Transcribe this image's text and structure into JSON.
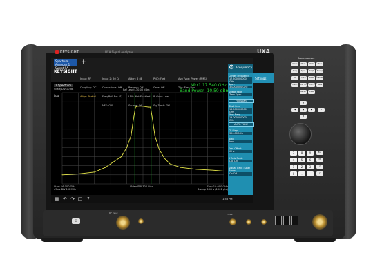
{
  "instrument": {
    "brand": "KEYSIGHT",
    "model_line": "UXA Signal Analyzer",
    "model_badge": "UXA",
    "measurement_group_label": "Measurement",
    "connector_label_left": "RF Input",
    "connector_label_right": "Probe"
  },
  "screen": {
    "logo_lines": [
      "Spectrum Analyzer 1",
      "Swept SA"
    ],
    "logo_color": "#1d58a8",
    "brand_text": "KEYSIGHT",
    "status_columns": [
      {
        "lines": [
          "Input: RF",
          "Coupling: DC",
          "Align: Partial"
        ],
        "color": "#cfcfcf"
      },
      {
        "lines": [
          "Input Z: 50 Ω",
          "Corrections: Off",
          "Freq Ref: Ext (S)",
          "NFE: Off"
        ],
        "color": "#cfcfcf"
      },
      {
        "lines": [
          "Atten: 6 dB",
          "Preamp: Off",
          "LNA: Not Enabled",
          "Source: Off"
        ],
        "color": "#cfcfcf"
      },
      {
        "lines": [
          "PNO: Fast",
          "Gate: Off",
          "IF Gain: Low",
          "Sig Track: Off"
        ],
        "color": "#cfcfcf"
      },
      {
        "lines": [
          "Avg Type: Power (RMS)",
          "Trig: Free Run"
        ],
        "color": "#cfcfcf"
      }
    ],
    "trace_label": "1 Spectrum",
    "scale_label": "Scale/Div 10 dB",
    "ref_label": "Ref Level -10.00 dBm",
    "marker_readout": "Mkr1  17.540 GHz",
    "band_power_readout": "Band Power  -10.50 dBm",
    "y_tick_top": "Log",
    "footer": {
      "start": "Start 16.000 GHz",
      "res_bw": "#Res BW 1.0 MHz",
      "video_bw": "Video BW 300 kHz",
      "stop": "Stop 19.000 GHz",
      "sweep": "Sweep 3.45 s (1001 pts)"
    },
    "taskbar_icons": [
      "windows-icon",
      "undo-icon",
      "redo-icon",
      "file-icon",
      "help-icon"
    ],
    "taskbar_time": "1:53 PM"
  },
  "menu_panel": {
    "title": "Frequency",
    "side_tab": "Settings",
    "items": [
      {
        "label": "Center Frequency",
        "value": "17.500000000 GHz"
      },
      {
        "label": "Span",
        "value": "3.0000000 GHz"
      },
      {
        "label": "Swept Span",
        "value": "Zero Span"
      },
      {
        "label": "Full Span",
        "value": ""
      },
      {
        "label": "Start Freq",
        "value": "16.000000000 GHz"
      },
      {
        "label": "Stop Freq",
        "value": "19.000000000 GHz"
      },
      {
        "label": "AUTO TUNE",
        "value": ""
      },
      {
        "label": "CF Step",
        "value": "300.00 MHz"
      },
      {
        "label": "Auto",
        "value": "Man"
      },
      {
        "label": "Freq Offset",
        "value": "0 Hz"
      },
      {
        "label": "X Axis Scale",
        "value": "Log Lin"
      },
      {
        "label": "Signal Track (Span Zoom)",
        "value": "On Off"
      }
    ],
    "panel_color": "#1f8fb1"
  },
  "hardkeys": [
    {
      "label": "Mode"
    },
    {
      "label": "Meas"
    },
    {
      "label": "Mode Setup"
    },
    {
      "label": "Meas Setup"
    },
    {
      "label": "Freq"
    },
    {
      "label": "Span"
    },
    {
      "label": "Ampt"
    },
    {
      "label": "Sweep"
    },
    {
      "label": "BW"
    },
    {
      "label": "Trace"
    },
    {
      "label": "Peak"
    },
    {
      "label": "Marker"
    },
    {
      "label": "Mkr→"
    },
    {
      "label": "Mkr Fn"
    },
    {
      "label": "Source"
    },
    {
      "label": "Save"
    },
    {
      "label": "Recall"
    },
    {
      "label": "Preset"
    }
  ],
  "keypad": [
    "7",
    "8",
    "9",
    "4",
    "5",
    "6",
    "1",
    "2",
    "3",
    "0",
    ".",
    "-"
  ],
  "chart_data": {
    "type": "line",
    "x_start_ghz": 16.0,
    "x_stop_ghz": 19.0,
    "ylim": [
      -110,
      -10
    ],
    "grid": true,
    "series": [
      {
        "name": "Trace 1",
        "color": "#e8e84a",
        "x": [
          16.0,
          16.3,
          16.6,
          16.8,
          16.95,
          17.1,
          17.2,
          17.28,
          17.32,
          17.36,
          17.4,
          17.5,
          17.6,
          17.64,
          17.68,
          17.72,
          17.8,
          17.9,
          18.0,
          18.2,
          18.5,
          18.8,
          19.0
        ],
        "y": [
          -100,
          -99,
          -97,
          -92,
          -86,
          -80,
          -70,
          -57,
          -40,
          -26,
          -25,
          -25,
          -26,
          -26,
          -40,
          -57,
          -72,
          -82,
          -88,
          -92,
          -94,
          -95,
          -96
        ]
      }
    ],
    "band_edges_ghz": [
      17.35,
      17.65
    ]
  }
}
